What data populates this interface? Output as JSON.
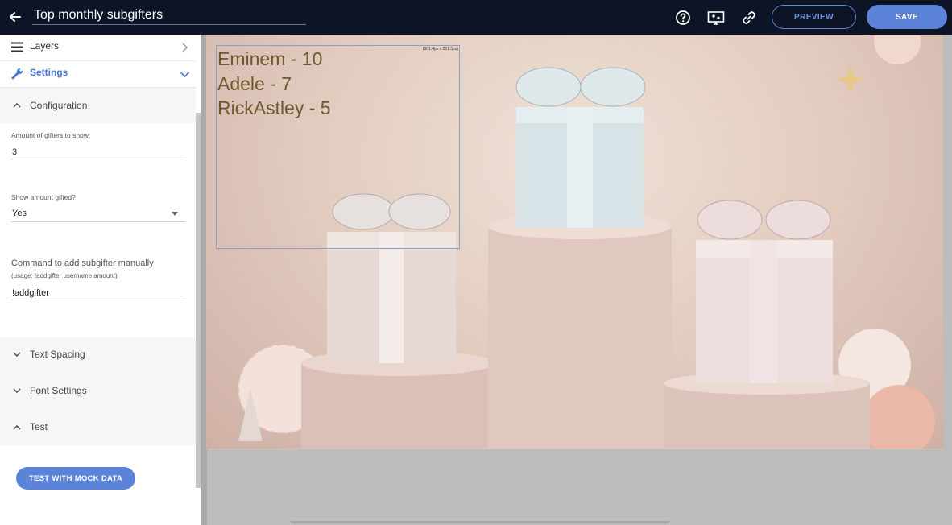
{
  "header": {
    "title_value": "Top monthly subgifters",
    "preview_label": "PREVIEW",
    "save_label": "SAVE"
  },
  "sidebar": {
    "layers_label": "Layers",
    "settings_label": "Settings",
    "configuration_label": "Configuration",
    "fields": {
      "amount_label": "Amount of gifters to show:",
      "amount_value": "3",
      "show_amount_label": "Show amount gifted?",
      "show_amount_value": "Yes",
      "command_label": "Command to add subgifter manually",
      "command_hint": "(usage: !addgifter username amount)",
      "command_value": "!addgifter"
    },
    "text_spacing_label": "Text Spacing",
    "font_settings_label": "Font Settings",
    "test_label": "Test",
    "mock_button_label": "TEST WITH MOCK DATA"
  },
  "canvas": {
    "widget_size_text": "(301.4px x 251.3px)",
    "gifters": [
      "Eminem - 10",
      "Adele - 7",
      "RickAstley - 5"
    ]
  },
  "colors": {
    "topbar_bg": "#0c1426",
    "accent_blue": "#5b84d8",
    "gifter_text": "#6c5a2e"
  },
  "icons": [
    "back-arrow-icon",
    "help-icon",
    "monitor-settings-icon",
    "link-icon",
    "layers-icon",
    "wrench-icon",
    "chevron-right-icon",
    "chevron-down-icon",
    "chevron-up-icon",
    "dropdown-caret-icon"
  ]
}
